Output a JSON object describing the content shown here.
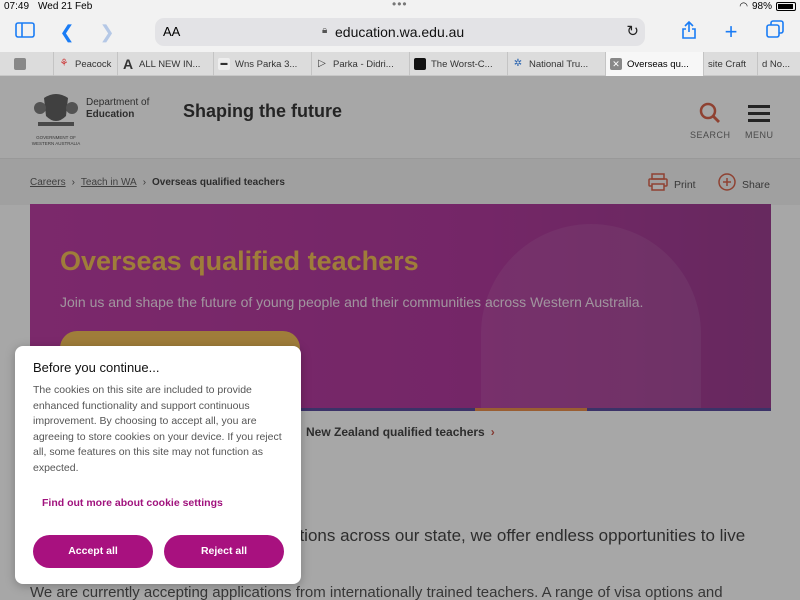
{
  "status": {
    "time": "07:49",
    "date": "Wed 21 Feb",
    "battery": "98%"
  },
  "toolbar": {
    "aa": "AA",
    "url": "education.wa.edu.au"
  },
  "tabs": [
    {
      "label": "",
      "icon": "reader-icon"
    },
    {
      "label": "Peacock",
      "icon": "peacock-favicon"
    },
    {
      "label": "ALL NEW IN...",
      "icon": "letter-a-favicon"
    },
    {
      "label": "Wns Parka 3...",
      "icon": "store-favicon"
    },
    {
      "label": "Parka - Didri...",
      "icon": "arrow-favicon"
    },
    {
      "label": "The Worst-C...",
      "icon": "square-favicon"
    },
    {
      "label": "National Tru...",
      "icon": "tree-favicon"
    },
    {
      "label": "Overseas qu...",
      "icon": "close-icon",
      "active": true
    },
    {
      "label": "site Craft",
      "icon": ""
    },
    {
      "label": "d No...",
      "icon": ""
    }
  ],
  "header": {
    "dept_line1": "Department of",
    "dept_line2": "Education",
    "crest_line1": "GOVERNMENT OF",
    "crest_line2": "WESTERN AUSTRALIA",
    "tagline": "Shaping the future",
    "search_label": "SEARCH",
    "menu_label": "MENU"
  },
  "breadcrumb": {
    "items": [
      "Careers",
      "Teach in WA"
    ],
    "current": "Overseas qualified teachers",
    "print_label": "Print",
    "share_label": "Share"
  },
  "hero": {
    "title": "Overseas qualified teachers",
    "subtitle": "Join us and shape the future of young people and their communities across Western Australia."
  },
  "subnav": {
    "link": "New Zealand qualified teachers"
  },
  "body": {
    "line1": "ations across our state, we offer endless opportunities to live",
    "line2": "We are currently accepting applications from internationally trained teachers. A range of visa options and"
  },
  "cookie": {
    "title": "Before you continue...",
    "message": "The cookies on this site are included to provide enhanced functionality and support continuous improvement. By choosing to accept all, you are agreeing to store cookies on your device. If you reject all, some features on this site may not function as expected.",
    "more_link": "Find out more about cookie settings",
    "accept": "Accept all",
    "reject": "Reject all"
  },
  "colors": {
    "brand_magenta": "#a8117f",
    "accent_gold": "#f0b33a",
    "accent_red": "#d4472a"
  }
}
